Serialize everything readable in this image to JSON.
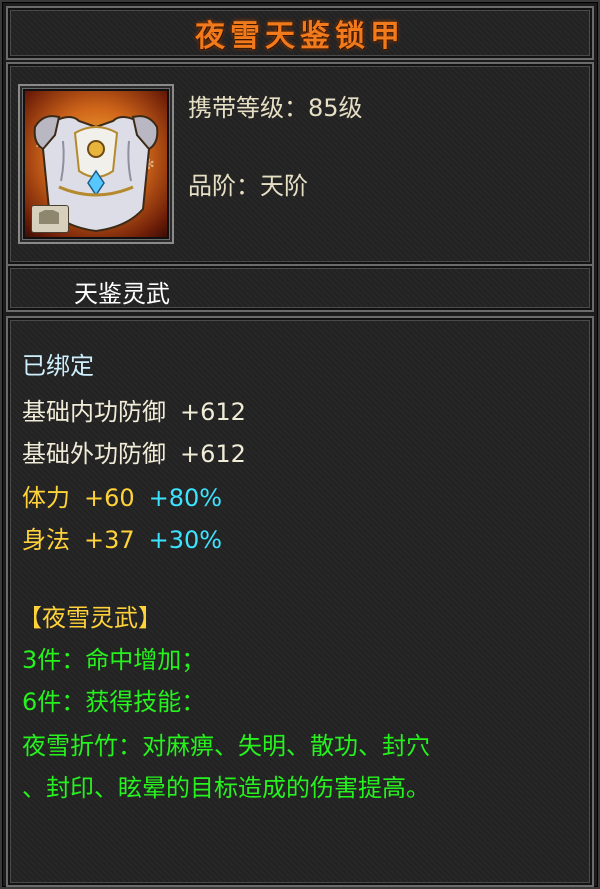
{
  "item": {
    "name": "夜雪天鉴锁甲",
    "level_label": "携带等级：",
    "level_value": "85级",
    "grade_label": "品阶：",
    "grade_value": "天阶",
    "series": "天鉴灵武",
    "icon": "armor-chestplate-icon",
    "bound_status": "已绑定",
    "base_stats": [
      {
        "name": "基础内功防御",
        "value": "+612"
      },
      {
        "name": "基础外功防御",
        "value": "+612"
      }
    ],
    "attributes": [
      {
        "name": "体力",
        "value": "+60",
        "percent": "+80%"
      },
      {
        "name": "身法",
        "value": "+37",
        "percent": "+30%"
      }
    ],
    "set": {
      "name": "【夜雪灵武】",
      "bonus_3": "3件：命中增加；",
      "bonus_6": "6件：获得技能：",
      "skill_line1": "夜雪折竹：对麻痹、失明、散功、封穴",
      "skill_line2": "、封印、眩晕的目标造成的伤害提高。"
    }
  },
  "colors": {
    "title": "#f07a1c",
    "stat_gold": "#ffd23a",
    "stat_cyan": "#3de3ff",
    "set_green": "#26f21e",
    "bound": "#cdeffd"
  }
}
